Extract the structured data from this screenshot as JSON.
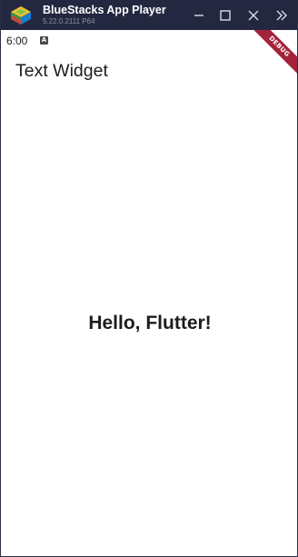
{
  "window": {
    "title": "BlueStacks App Player",
    "version": "5.22.0.2111  P64",
    "controls": {
      "minimize": "minimize-icon",
      "maximize": "maximize-icon",
      "close": "close-icon",
      "more": "double-chevron-right-icon"
    }
  },
  "statusbar": {
    "time": "6:00",
    "indicator": "A"
  },
  "appbar": {
    "title": "Text Widget"
  },
  "body": {
    "text": "Hello, Flutter!"
  },
  "debug_banner": {
    "label": "DEBUG"
  },
  "colors": {
    "titlebar_bg": "#232840",
    "debug_ribbon": "#a3233b",
    "text": "#1d1d1d"
  }
}
